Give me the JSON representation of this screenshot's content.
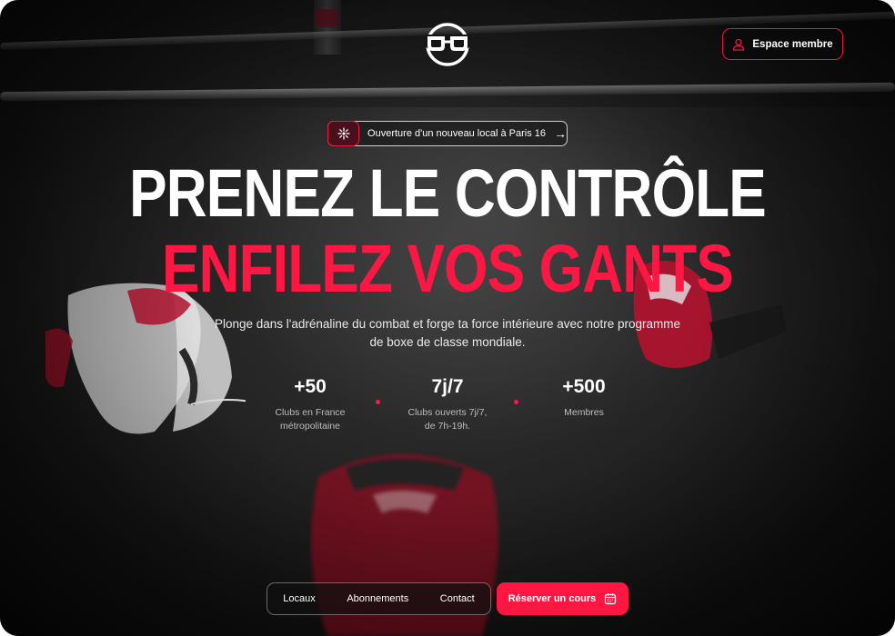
{
  "header": {
    "logo_icon": "boxing-headgear-logo-icon",
    "member_button_label": "Espace membre",
    "member_icon": "user-icon"
  },
  "announcement": {
    "icon": "sparkle-icon",
    "text": "Ouverture d'un nouveau local à Paris 16",
    "arrow_icon": "arrow-right-icon"
  },
  "hero": {
    "title_line1": "PRENEZ LE CONTRÔLE",
    "title_line2": "ENFILEZ VOS GANTS",
    "subtitle": "Plonge dans l'adrénaline du combat et forge ta force intérieure avec notre programme de boxe de classe mondiale."
  },
  "stats": [
    {
      "value": "+50",
      "label": "Clubs en France métropolitaine"
    },
    {
      "value": "7j/7",
      "label": "Clubs ouverts 7j/7, de 7h-19h."
    },
    {
      "value": "+500",
      "label": "Membres"
    }
  ],
  "nav": {
    "items": [
      "Locaux",
      "Abonnements",
      "Contact"
    ],
    "cta_label": "Réserver un cours",
    "cta_icon": "calendar-icon"
  },
  "colors": {
    "accent": "#ff1744",
    "background": "#141414",
    "text": "#ffffff"
  }
}
